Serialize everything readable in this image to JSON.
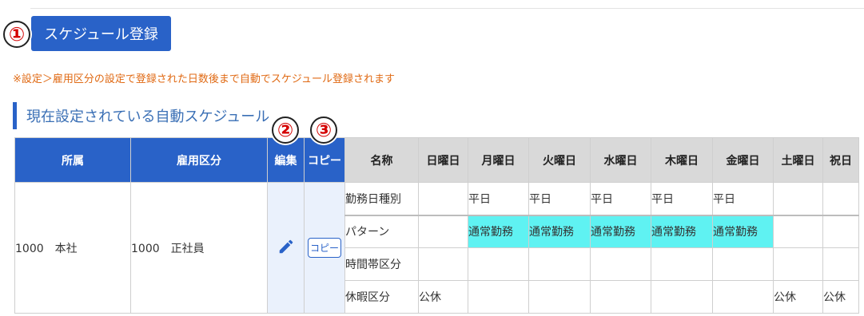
{
  "markers": {
    "m1": "①",
    "m2": "②",
    "m3": "③"
  },
  "toolbar": {
    "schedule_button": "スケジュール登録"
  },
  "note": "※設定＞雇用区分の設定で登録された日数後まで自動でスケジュール登録されます",
  "section_title": "現在設定されている自動スケジュール",
  "table": {
    "headers": {
      "affiliation": "所属",
      "employment": "雇用区分",
      "edit": "編集",
      "copy": "コピー",
      "name": "名称",
      "days": [
        "日曜日",
        "月曜日",
        "火曜日",
        "水曜日",
        "木曜日",
        "金曜日",
        "土曜日",
        "祝日"
      ]
    },
    "row": {
      "affiliation": "1000　本社",
      "employment": "1000　正社員",
      "edit_icon": "pencil-icon",
      "copy_label": "コピー",
      "patterns": [
        {
          "name": "勤務日種別",
          "days": [
            "",
            "平日",
            "平日",
            "平日",
            "平日",
            "平日",
            "",
            ""
          ]
        },
        {
          "name": "パターン",
          "days": [
            "",
            "通常勤務",
            "通常勤務",
            "通常勤務",
            "通常勤務",
            "通常勤務",
            "",
            ""
          ]
        },
        {
          "name": "時間帯区分",
          "days": [
            "",
            "",
            "",
            "",
            "",
            "",
            "",
            ""
          ]
        },
        {
          "name": "休暇区分",
          "days": [
            "公休",
            "",
            "",
            "",
            "",
            "",
            "公休",
            "公休"
          ]
        }
      ]
    }
  },
  "colors": {
    "primary": "#2962c8",
    "note": "#e06a14",
    "highlight": "#5ff2f2",
    "header_gray": "#d9d9d9",
    "marker": "#d40000"
  }
}
